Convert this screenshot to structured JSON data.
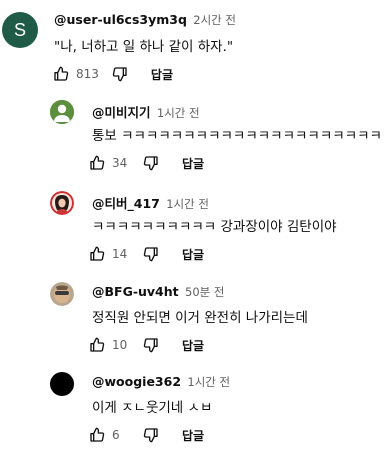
{
  "top_comment": {
    "avatar_letter": "S",
    "avatar_color": "#1f5b46",
    "author": "@user-ul6cs3ym3q",
    "time": "2시간 전",
    "text": "\"나, 너하고 일 하나 같이 하자.\"",
    "likes": "813",
    "reply_label": "답글"
  },
  "replies": [
    {
      "author": "@미비지기",
      "time": "1시간 전",
      "text": "통보 ㅋㅋㅋㅋㅋㅋㅋㅋㅋㅋㅋㅋㅋㅋㅋㅋㅋㅋㅋㅋㅋ",
      "likes": "34",
      "reply_label": "답글",
      "avatar_color": "#5a8a3a"
    },
    {
      "author": "@티버_417",
      "time": "1시간 전",
      "text": "ㅋㅋㅋㅋㅋㅋㅋㅋㅋㅋ 강과장이야 김탄이야",
      "likes": "14",
      "reply_label": "답글",
      "avatar_color": "#d32c2c"
    },
    {
      "author": "@BFG-uv4ht",
      "time": "50분 전",
      "text": "정직원 안되면 이거 완전히 나가리는데",
      "likes": "10",
      "reply_label": "답글",
      "avatar_color": "#a08a70"
    },
    {
      "author": "@woogie362",
      "time": "1시간 전",
      "text": "이게 ㅈㄴ웃기네 ㅅㅂ",
      "likes": "6",
      "reply_label": "답글",
      "avatar_color": "#000000"
    }
  ],
  "icons": {
    "like": "thumbs-up-icon",
    "dislike": "thumbs-down-icon"
  },
  "colors": {
    "text": "#0f0f0f",
    "secondary": "#606060"
  }
}
